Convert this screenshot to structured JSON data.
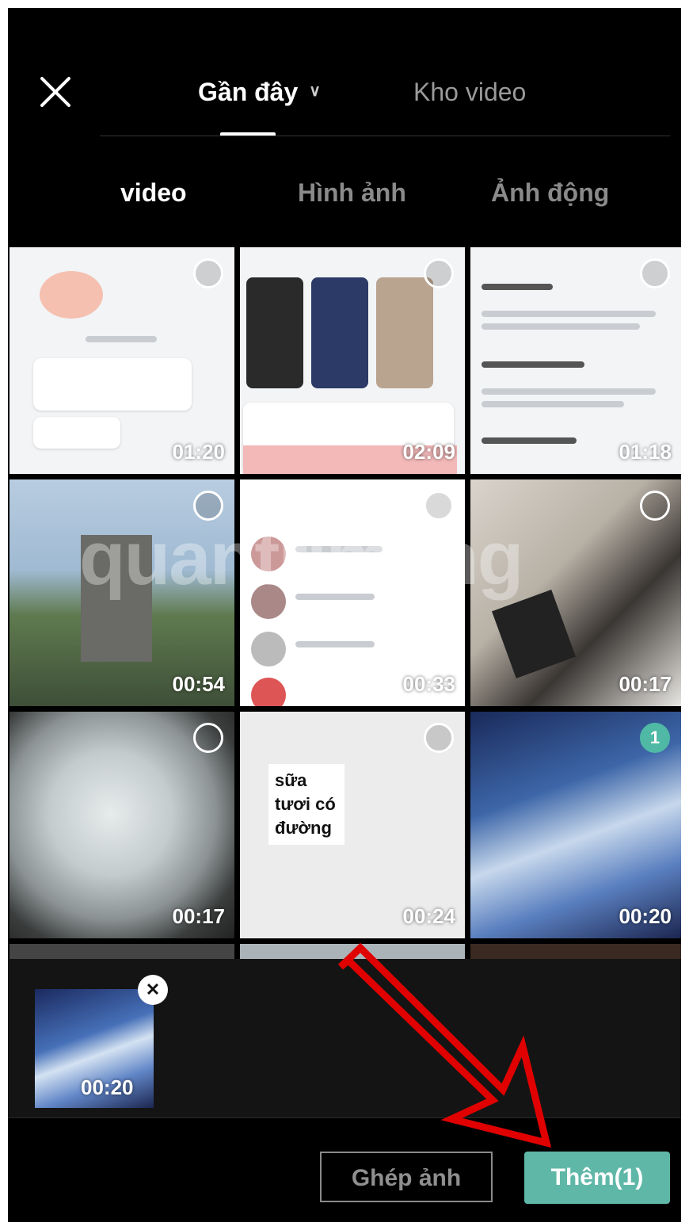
{
  "header": {
    "tabs": [
      {
        "label": "Gần đây",
        "active": true
      },
      {
        "label": "Kho video",
        "active": false
      }
    ],
    "close_icon": "close-icon"
  },
  "subtabs": [
    {
      "label": "video",
      "active": true
    },
    {
      "label": "Hình ảnh",
      "active": false
    },
    {
      "label": "Ảnh động",
      "active": false
    }
  ],
  "tiles": [
    {
      "duration": "01:20"
    },
    {
      "duration": "02:09"
    },
    {
      "duration": "01:18"
    },
    {
      "duration": "00:54"
    },
    {
      "duration": "00:33"
    },
    {
      "duration": "00:17"
    },
    {
      "duration": "00:17"
    },
    {
      "duration": "00:24",
      "caption": "sữa tươi có đường"
    },
    {
      "duration": "00:20",
      "selected_index": "1"
    }
  ],
  "selected": {
    "duration": "00:20",
    "remove_icon": "close-icon"
  },
  "buttons": {
    "ghep_anh": "Ghép ảnh",
    "them": "Thêm(1)"
  },
  "colors": {
    "accent": "#5fb7a7",
    "background": "#000000",
    "arrow": "#e00000"
  }
}
